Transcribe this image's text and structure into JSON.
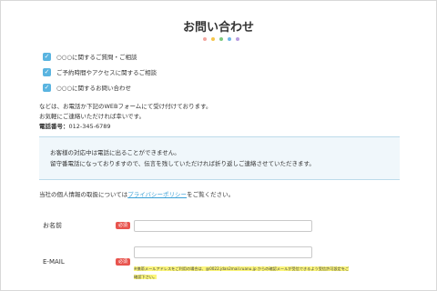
{
  "title": "お問い合わせ",
  "dot_colors": [
    "#f2a7a0",
    "#f5c54a",
    "#7cc97e",
    "#6fb6e6",
    "#b89de0"
  ],
  "checkbox_color": "#5ab4e0",
  "checkboxes": [
    {
      "label": "○○○に関するご質問・ご相談",
      "checked": true
    },
    {
      "label": "ご予約時間やアクセスに関するご相談",
      "checked": true
    },
    {
      "label": "○○○に関するお問い合わせ",
      "checked": true
    }
  ],
  "info": {
    "line1": "などは、お電話か下記のWEBフォームにて受け付けております。",
    "line2": "お気軽にご連絡いただければ幸いです。",
    "phone_label": "電話番号：",
    "phone_number": "012-345-6789"
  },
  "notice": {
    "line1": "お客様の対応中は電話に出ることができません。",
    "line2": "留守番電話になっておりますので、伝言を残していただければ折り返しご連絡させていただきます。"
  },
  "privacy": {
    "before": "当社の個人情報の取扱については",
    "link": "プライバシーポリシー",
    "after": "をご覧ください。"
  },
  "required_badge": "必須",
  "required_color": "#e8544e",
  "fields": {
    "name_label": "お名前",
    "email_label": "E-MAIL",
    "email_hint_line1": "※携帯メールアドレスをご利用の場合は、@0022.jdan2mail.ruanu.jp からの確認メールが受信できるよう受信許可設定をご",
    "email_hint_line2": "確認下さい。"
  }
}
